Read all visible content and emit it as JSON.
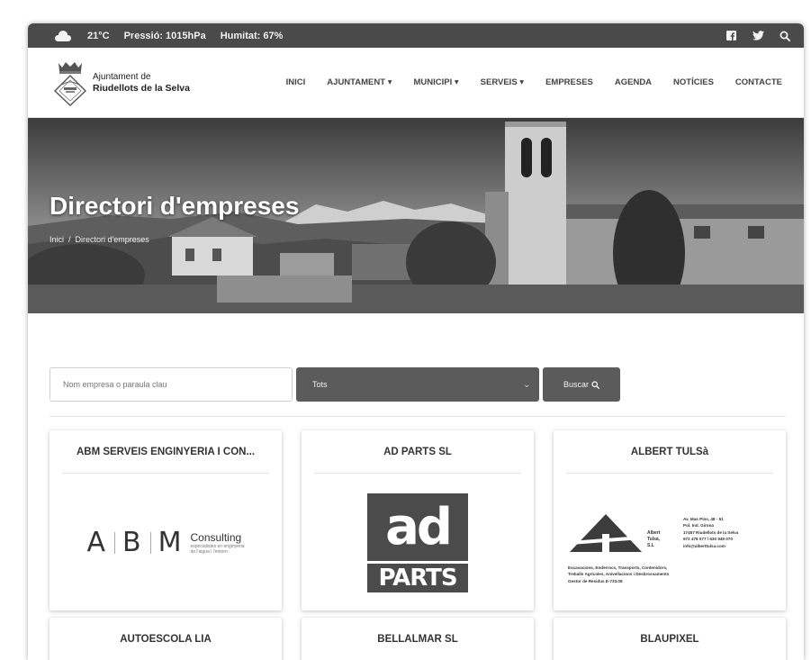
{
  "topbar": {
    "temperature": "21°C",
    "pressure": "Pressió: 1015hPa",
    "humidity": "Humitat: 67%",
    "icons": [
      "cloud-icon",
      "facebook-icon",
      "twitter-icon",
      "search-icon"
    ]
  },
  "header": {
    "logo_line1": "Ajuntament de",
    "logo_line2": "Riudellots de la Selva",
    "nav": [
      "INICI",
      "AJUNTAMENT",
      "MUNICIPI",
      "SERVEIS",
      "EMPRESES",
      "AGENDA",
      "NOTÍCIES",
      "CONTACTE"
    ]
  },
  "hero": {
    "title": "Directori d'empreses",
    "breadcrumb_home": "Inici",
    "breadcrumb_sep": "/",
    "breadcrumb_current": "Directori d'empreses"
  },
  "search": {
    "placeholder": "Nom empresa o paraula clau",
    "category_selected": "Tots",
    "button_label": "Buscar"
  },
  "companies": [
    {
      "name": "ABM SERVEIS ENGINYERIA I CON...",
      "logo": {
        "letters": [
          "A",
          "B",
          "M"
        ],
        "word": "Consulting",
        "tagline1": "especialistes en enginyeria",
        "tagline2": "de l'aigua i l'entorn"
      }
    },
    {
      "name": "AD PARTS SL",
      "logo": {
        "top": "ad",
        "bottom": "PARTS"
      }
    },
    {
      "name": "ALBERT TULSà",
      "logo": {
        "brand1": "Albert",
        "brand2": "Tulsà,",
        "brand3": "S.L",
        "address": [
          "Av. Mas Pins, 48 - 51",
          "Pol. Ind. Girona",
          "17457 Riudellots de la Selva",
          "972 478 077 / 630 949 070",
          "info@alberttulsa.com"
        ],
        "services": [
          "Excavacions, Enderrocs, Transports, Contenidors,",
          "Treballs Agrícoles, Anivellacions i Desbrossaments",
          "Gestor de Residus E-733.08"
        ]
      }
    },
    {
      "name": "AUTOESCOLA LIA"
    },
    {
      "name": "BELLALMAR SL"
    },
    {
      "name": "BLAUPIXEL"
    }
  ]
}
